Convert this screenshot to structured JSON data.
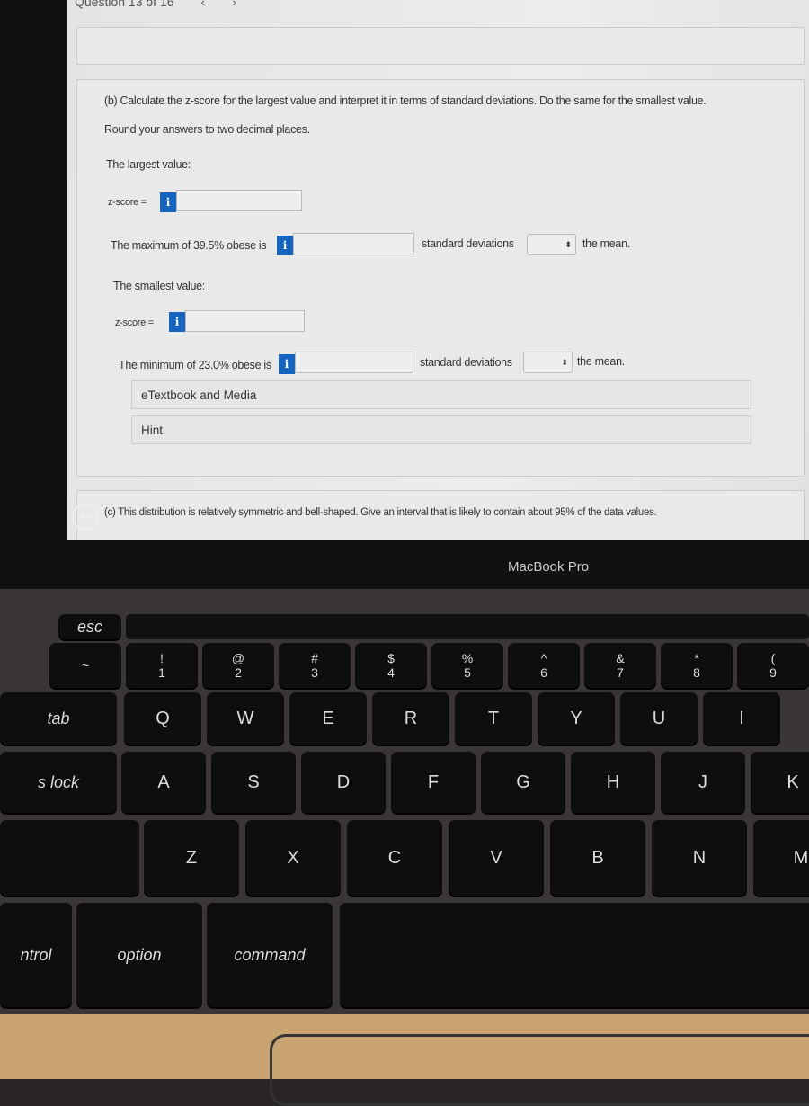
{
  "header": {
    "question_counter": "Question 13 of 16",
    "prev_icon": "chevron-left-icon",
    "next_icon": "chevron-right-icon"
  },
  "part_b": {
    "prompt": "(b) Calculate the z-score for the largest value and interpret it in terms of standard deviations. Do the same for the smallest value.",
    "instruction": "Round your answers to two decimal places.",
    "largest_label": "The largest value:",
    "zscore_label": "z-score =",
    "max_sentence": "The maximum of 39.5% obese is",
    "std_dev_label": "standard deviations",
    "the_mean": "the mean.",
    "smallest_label": "The smallest value:",
    "min_sentence": "The minimum of 23.0% obese is",
    "info_glyph": "i",
    "max_zscore_value": "",
    "max_sd_value": "",
    "max_direction": "",
    "min_zscore_value": "",
    "min_sd_value": "",
    "min_direction": ""
  },
  "resources": {
    "etextbook": "eTextbook and Media",
    "hint": "Hint"
  },
  "part_c": {
    "prompt": "(c) This distribution is relatively symmetric and bell-shaped. Give an interval that is likely to contain about 95% of the data values."
  },
  "laptop": {
    "brand": "MacBook Pro"
  },
  "keyboard": {
    "esc": "esc",
    "tilde": "~",
    "numbers": [
      [
        "!",
        "1"
      ],
      [
        "@",
        "2"
      ],
      [
        "#",
        "3"
      ],
      [
        "$",
        "4"
      ],
      [
        "%",
        "5"
      ],
      [
        "^",
        "6"
      ],
      [
        "&",
        "7"
      ],
      [
        "*",
        "8"
      ],
      [
        "(",
        "9"
      ]
    ],
    "row_q": [
      "Q",
      "W",
      "E",
      "R",
      "T",
      "Y",
      "U",
      "I"
    ],
    "row_a": [
      "A",
      "S",
      "D",
      "F",
      "G",
      "H",
      "J",
      "K"
    ],
    "row_z": [
      "Z",
      "X",
      "C",
      "V",
      "B",
      "N",
      "M"
    ],
    "tab": "tab",
    "caps": "s lock",
    "control": "ntrol",
    "option": "option",
    "command": "command",
    "option_symbol": "⌥",
    "command_symbol": "⌘",
    "ctrl_symbol": "^"
  }
}
